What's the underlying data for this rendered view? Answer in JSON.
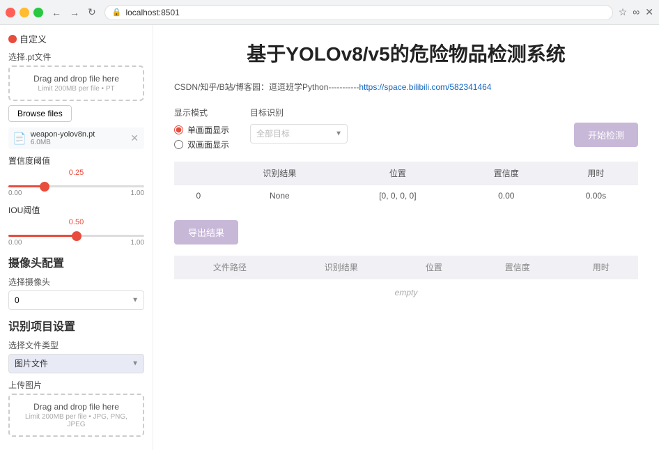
{
  "browser": {
    "url": "localhost:8501",
    "back_label": "←",
    "forward_label": "→",
    "reload_label": "↻"
  },
  "sidebar": {
    "title": "自定义",
    "pt_file_section": "选择.pt文件",
    "dropzone_title": "Drag and drop file here",
    "dropzone_limit": "Limit 200MB per file • PT",
    "browse_label": "Browse files",
    "file_name": "weapon-yolov8n.pt",
    "file_size": "6.0MB",
    "confidence_label": "置信度阈值",
    "confidence_value": "0.25",
    "confidence_min": "0.00",
    "confidence_max": "1.00",
    "iou_label": "IOU阈值",
    "iou_value": "0.50",
    "iou_min": "0.00",
    "iou_max": "1.00",
    "camera_heading": "摄像头配置",
    "camera_label": "选择摄像头",
    "camera_option": "0",
    "recognition_heading": "识别项目设置",
    "filetype_label": "选择文件类型",
    "filetype_option": "图片文件",
    "upload_label": "上传图片",
    "upload_dropzone_title": "Drag and drop file here",
    "upload_dropzone_limit": "Limit 200MB per file • JPG, PNG, JPEG"
  },
  "main": {
    "page_title": "基于YOLOv8/v5的危险物品检测系统",
    "info_text": "CSDN/知乎/B站/博客园：逗逗班学Python-----------",
    "info_link_text": "https://space.bilibili.com/582341464",
    "info_link_url": "https://space.bilibili.com/582341464",
    "display_mode_label": "显示模式",
    "radio_single": "单画面显示",
    "radio_double": "双画面显示",
    "target_label": "目标识别",
    "target_placeholder": "全部目标",
    "start_btn_label": "开始检测",
    "detect_table": {
      "headers": [
        "识别结果",
        "位置",
        "置信度",
        "用时"
      ],
      "rows": [
        {
          "index": "0",
          "result": "None",
          "position": "[0, 0, 0, 0]",
          "confidence": "0.00",
          "time": "0.00s"
        }
      ]
    },
    "export_btn_label": "导出结果",
    "result_table": {
      "headers": [
        "文件路径",
        "识别结果",
        "位置",
        "置信度",
        "用时"
      ],
      "empty_text": "empty"
    }
  }
}
